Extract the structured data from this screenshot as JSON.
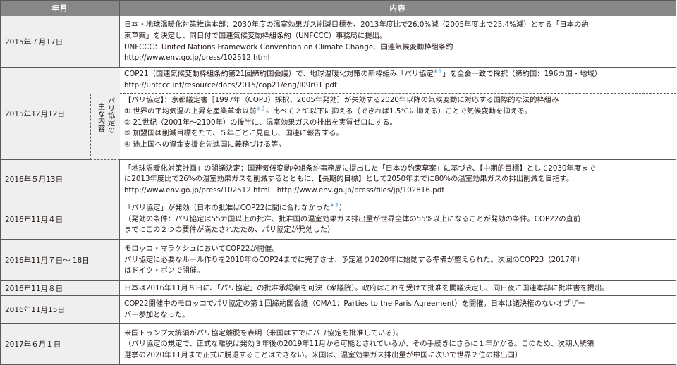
{
  "header": {
    "col_date": "年月",
    "col_content": "内容"
  },
  "rows": [
    {
      "date": "2015年７月17日",
      "lines": [
        "日本・地球温暖化対策推進本部：2030年度の温室効果ガス削減目標を、2013年度比で26.0%減（2005年度比で25.4%減）とする「日本の約",
        "束草案」を決定し、同日付で国連気候変動枠組条約（UNFCCC）事務局に提出。",
        "UNFCCC：United Nations Framework Convention on Climate Change、国連気候変動枠組条約",
        "http://www.env.go.jp/press/102512.html"
      ]
    },
    {
      "date": "2015年12月12日",
      "lines_a": [
        "COP21（国連気候変動枠組条約第21回締約国会議）で、地球温暖化対策の新枠組み「パリ協定",
        "※１",
        "」を全会一致で採択（締約国：196カ国・地域）",
        "http://unfccc.int/resource/docs/2015/cop21/eng/l09r01.pdf"
      ],
      "sublabel": {
        "col1": "パリ協定の",
        "col2": "主な内容"
      },
      "lines_b": [
        "【パリ協定】：京都議定書［1997年（COP3）採択、2005年発効］が失効する2020年以降の気候変動に対応する国際的な法的枠組み",
        "① 世界の平均気温の上昇を産業革命以前",
        "※２",
        "に比べて２℃以下に抑える（できれば1.5℃に抑える）ことで気候変動を抑える。",
        "② 21世紀（2001年～2100年）の後半に、温室効果ガスの排出を実質ゼロにする。",
        "③ 加盟国は削減目標をたて、５年ごとに見直し、国連に報告する。",
        "④ 途上国への資金支援を先進国に義務づける等。"
      ]
    },
    {
      "date": "2016年５月13日",
      "lines": [
        "「地球温暖化対策計画」の閣議決定：国連気候変動枠組条約事務局に提出した「日本の約束草案」に基づき、【中期的目標】として2030年度まで",
        "に2013年度比で26%の温室効果ガスを削減するとともに、【長期的目標】として2050年までに80%の温室効果ガスの排出削減を目指す。",
        "http://www.env.go.jp/press/102512.html　http://www.env.go.jp/press/files/jp/102816.pdf"
      ]
    },
    {
      "date": "2016年11月４日",
      "lines": [
        "「パリ協定」が発効（日本の批准はCOP22に間に合わなかった",
        "※３",
        "）",
        "（発効の条件：パリ協定は55カ国以上の批准、批准国の温室効果ガス排出量が世界全体の55%以上になることが発効の条件。COP22の直前",
        "までにこの２つの要件が満たされたため、パリ協定が発効した）"
      ]
    },
    {
      "date": "2016年11月７日～ 18日",
      "lines": [
        "モロッコ・マラケシュにおいてCOP22が開催。",
        "パリ協定に必要なルール作りを2018年のCOP24までに完了させ、予定通り2020年に始動する準備が整えられた。次回のCOP23（2017年）",
        "はドイツ・ボンで開催。"
      ]
    },
    {
      "date": "2016年11月８日",
      "lines": [
        "日本は2016年11月８日に、「パリ協定」の批准承認案を可決（衆議院）。政府はこれを受けて批准を閣議決定し、同日夜に国連本部に批准書を提出。"
      ]
    },
    {
      "date": "2016年11月15日",
      "lines": [
        "COP22開催中のモロッコでパリ協定の第１回締約国会議（CMA1：Parties to the Paris Agreement）を開催。日本は議決権のないオブザー",
        "バー参加となった。"
      ]
    },
    {
      "date": "2017年６月１日",
      "lines": [
        "米国トランプ大統領がパリ協定離脱を表明（米国はすでにパリ協定を批准している）。",
        "（パリ協定の規定で、正式な離脱は発効３年後の2019年11月から可能とされているが、その手続きにさらに１年かかる。このため、次期大統領",
        "選挙の2020年11月まで正式に脱退することはできない。米国は、温室効果ガス排出量が中国に次いで世界２位の排出国）"
      ]
    }
  ]
}
